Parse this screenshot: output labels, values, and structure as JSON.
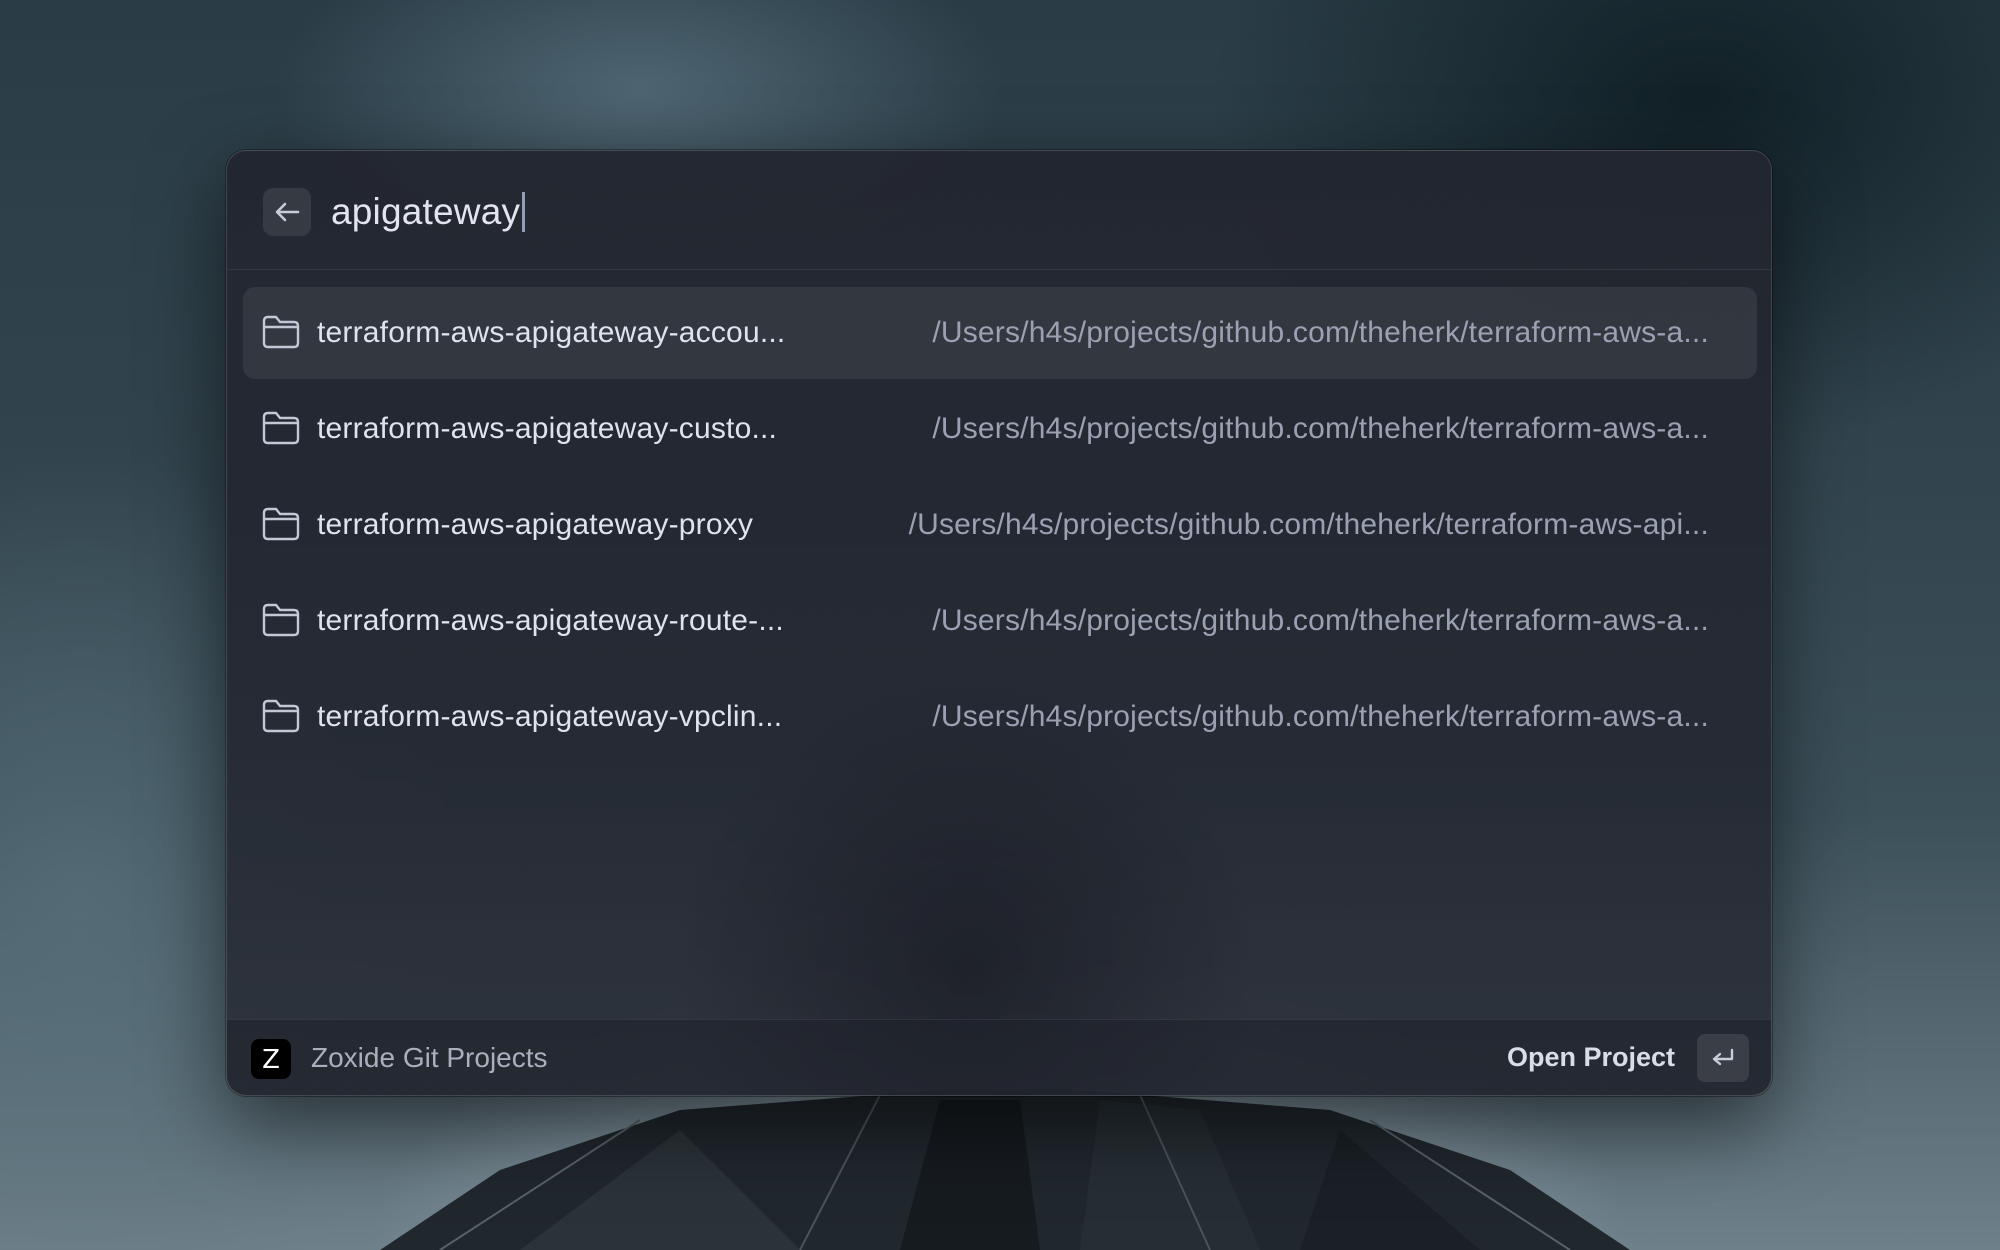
{
  "search": {
    "query": "apigateway"
  },
  "results": [
    {
      "name": "terraform-aws-apigateway-accou...",
      "path": "/Users/h4s/projects/github.com/theherk/terraform-aws-a...",
      "selected": true
    },
    {
      "name": "terraform-aws-apigateway-custo...",
      "path": "/Users/h4s/projects/github.com/theherk/terraform-aws-a...",
      "selected": false
    },
    {
      "name": "terraform-aws-apigateway-proxy",
      "path": "/Users/h4s/projects/github.com/theherk/terraform-aws-api...",
      "selected": false
    },
    {
      "name": "terraform-aws-apigateway-route-...",
      "path": "/Users/h4s/projects/github.com/theherk/terraform-aws-a...",
      "selected": false
    },
    {
      "name": "terraform-aws-apigateway-vpclin...",
      "path": "/Users/h4s/projects/github.com/theherk/terraform-aws-a...",
      "selected": false
    }
  ],
  "footer": {
    "logo_letter": "Z",
    "extension_name": "Zoxide Git Projects",
    "primary_action": "Open Project"
  },
  "icons": {
    "back": "arrow-left-icon",
    "result": "folder-icon",
    "enter": "return-key-icon"
  },
  "colors": {
    "palette_bg": "#232733",
    "selected_row": "#2e323e",
    "text_primary": "#dfe3ee",
    "text_secondary": "#9aa1b2"
  }
}
